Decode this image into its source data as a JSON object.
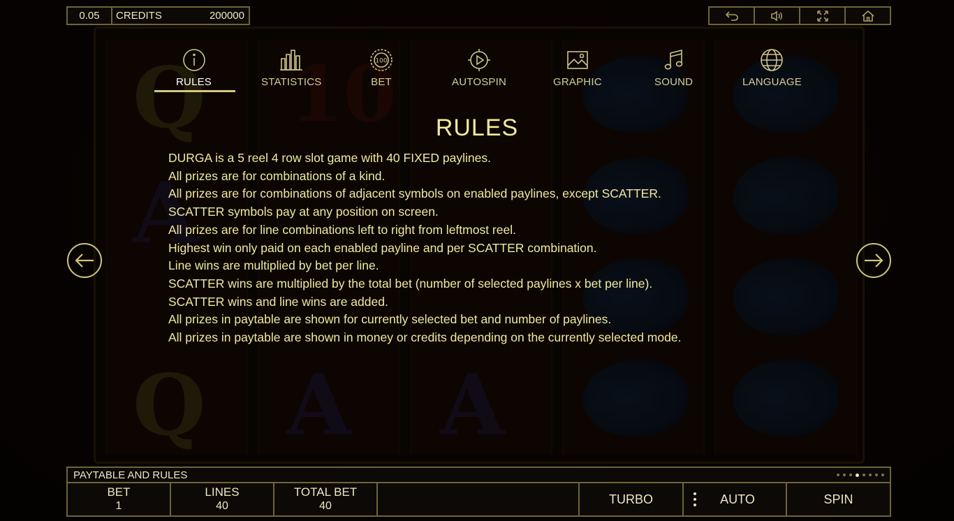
{
  "top_bar": {
    "denomination": "0.05",
    "credits_label": "CREDITS",
    "credits_value": "200000",
    "buttons": [
      {
        "icon": "undo-arrow-icon"
      },
      {
        "icon": "speaker-icon"
      },
      {
        "icon": "fullscreen-icon"
      },
      {
        "icon": "home-icon"
      }
    ]
  },
  "tabs": [
    {
      "label": "RULES",
      "icon": "info-icon",
      "active": true
    },
    {
      "label": "STATISTICS",
      "icon": "bar-chart-icon",
      "active": false
    },
    {
      "label": "BET",
      "icon": "chip-100-icon",
      "active": false
    },
    {
      "label": "AUTOSPIN",
      "icon": "autoplay-icon",
      "active": false
    },
    {
      "label": "GRAPHIC",
      "icon": "image-icon",
      "active": false
    },
    {
      "label": "SOUND",
      "icon": "music-note-icon",
      "active": false
    },
    {
      "label": "LANGUAGE",
      "icon": "globe-icon",
      "active": false
    }
  ],
  "rules": {
    "title": "RULES",
    "lines": [
      "DURGA is a 5 reel 4 row slot game with 40 FIXED paylines.",
      "All prizes are for combinations of a kind.",
      "All prizes are for combinations of adjacent symbols on enabled paylines, except SCATTER.",
      "SCATTER symbols pay at any position on screen.",
      "All prizes are for line combinations left to right from leftmost reel.",
      "Highest win only paid on each enabled payline and per SCATTER combination.",
      "Line wins are multiplied by bet per line.",
      "SCATTER wins are multiplied by the total bet (number of selected paylines x bet per line).",
      "SCATTER wins and line wins are added.",
      "All prizes in paytable are shown for currently selected bet and number of paylines.",
      "All prizes in paytable are shown in money or credits depending on the currently selected mode."
    ]
  },
  "bottom": {
    "section_label": "PAYTABLE AND RULES",
    "page_indicator": {
      "total": 8,
      "current": 4
    },
    "bet_label": "BET",
    "bet_value": "1",
    "lines_label": "LINES",
    "lines_value": "40",
    "total_bet_label": "TOTAL BET",
    "total_bet_value": "40",
    "turbo_label": "TURBO",
    "auto_label": "AUTO",
    "spin_label": "SPIN"
  },
  "colors": {
    "accent_gold": "#f1e9a0",
    "border": "#6f6438",
    "background": "#0c0906"
  }
}
